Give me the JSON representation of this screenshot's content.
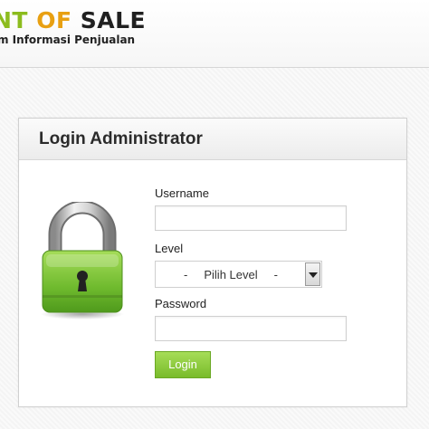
{
  "header": {
    "brand_part1": "NT",
    "brand_part2": "OF",
    "brand_part3": "SALE",
    "tagline": "m Informasi Penjualan"
  },
  "login": {
    "title": "Login Administrator",
    "icon": "lock-icon",
    "username_label": "Username",
    "username_value": "",
    "level_label": "Level",
    "level_selected": "-     Pilih Level     -",
    "password_label": "Password",
    "password_value": "",
    "button_label": "Login"
  },
  "colors": {
    "brand_green": "#8cbc1e",
    "brand_orange": "#e8a012",
    "button_green": "#8ccc3e",
    "lock_green": "#7cc43a"
  }
}
